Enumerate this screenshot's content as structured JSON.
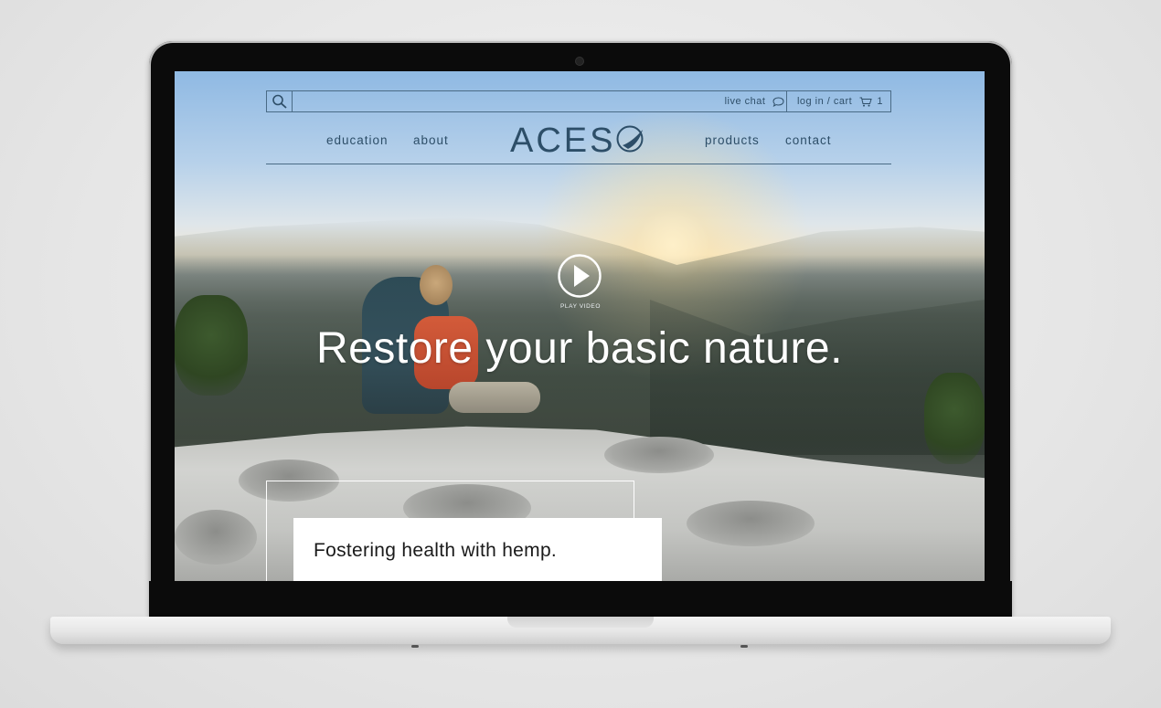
{
  "header": {
    "live_chat": "live chat",
    "login_cart": "log in / cart",
    "cart_count": "1",
    "search_icon": "search-icon",
    "chat_icon": "chat-bubble-icon",
    "cart_icon": "cart-icon"
  },
  "nav": {
    "education": "education",
    "about": "about",
    "products": "products",
    "contact": "contact"
  },
  "brand": {
    "logo_prefix": "ACES",
    "logo_suffix_icon": "aceso-o-logo-icon",
    "color": "#2d4e68"
  },
  "hero": {
    "play_label": "PLAY VIDEO",
    "play_icon": "play-icon",
    "headline": "Restore your basic nature."
  },
  "card": {
    "text": "Fostering health with hemp."
  }
}
